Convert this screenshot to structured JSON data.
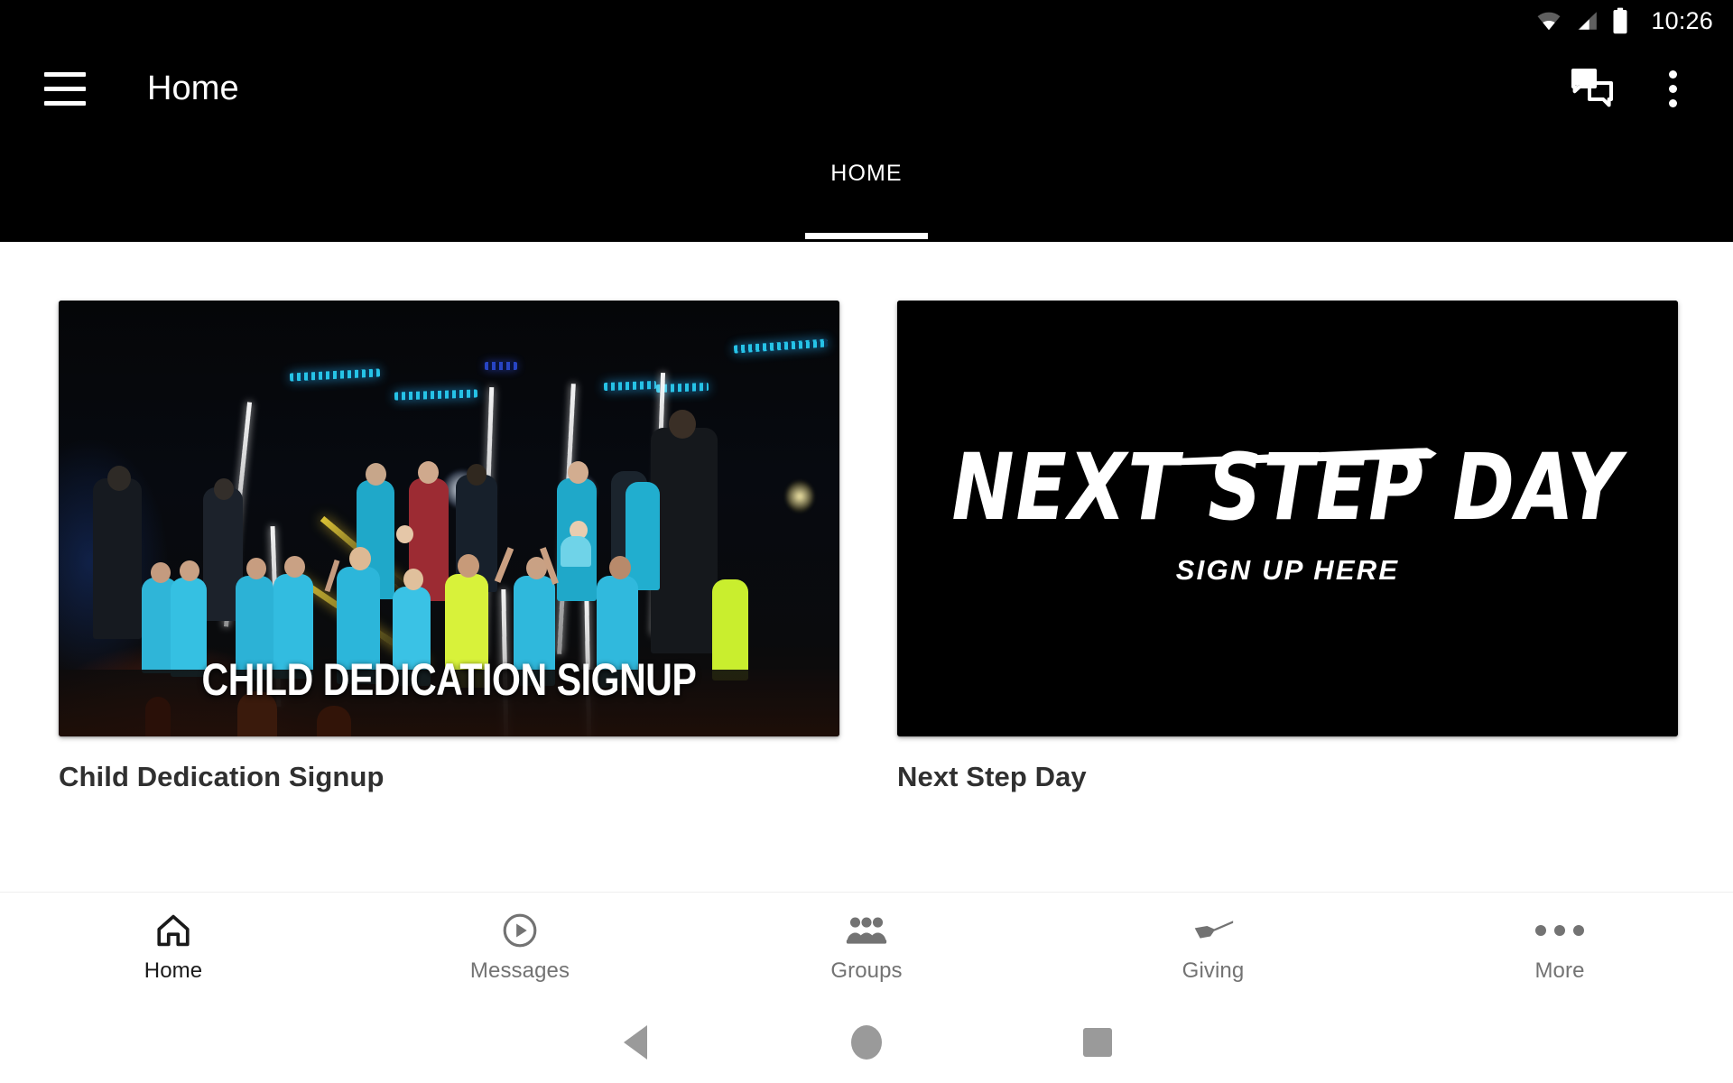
{
  "status_bar": {
    "time": "10:26",
    "icons": [
      "wifi-icon",
      "cellular-signal-icon",
      "battery-icon"
    ]
  },
  "app_bar": {
    "menu_icon": "hamburger-menu-icon",
    "title": "Home",
    "actions": [
      {
        "name": "messages-icon",
        "label": "Messages"
      },
      {
        "name": "overflow-menu-icon",
        "label": "More options"
      }
    ]
  },
  "tabs": [
    {
      "label": "HOME",
      "active": true
    }
  ],
  "main": {
    "cards": [
      {
        "title": "Child Dedication Signup",
        "media_type": "photo",
        "overlay_text": "CHILD DEDICATION SIGNUP"
      },
      {
        "title": "Next Step Day",
        "media_type": "graphic",
        "overlay_text": "NEXT STEP DAY",
        "overlay_subtext": "SIGN UP HERE"
      }
    ]
  },
  "bottom_nav": [
    {
      "label": "Home",
      "icon": "home-icon",
      "active": true
    },
    {
      "label": "Messages",
      "icon": "play-circle-icon",
      "active": false
    },
    {
      "label": "Groups",
      "icon": "people-group-icon",
      "active": false
    },
    {
      "label": "Giving",
      "icon": "open-hand-icon",
      "active": false
    },
    {
      "label": "More",
      "icon": "more-horizontal-icon",
      "active": false
    }
  ],
  "system_nav": [
    {
      "label": "Back",
      "icon": "back-triangle-icon"
    },
    {
      "label": "Home",
      "icon": "home-circle-icon"
    },
    {
      "label": "Recents",
      "icon": "recents-square-icon"
    }
  ],
  "colors": {
    "app_bar_bg": "#000000",
    "content_bg": "#ffffff",
    "active_nav": "#1a1a1a",
    "inactive_nav": "#737373",
    "card_title": "#303030"
  }
}
